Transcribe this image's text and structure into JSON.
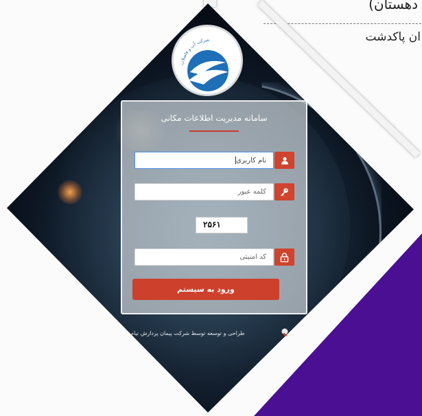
{
  "document": {
    "header_text": "دهستان)",
    "subheader_text": "ان پاکدشت"
  },
  "login": {
    "org_name_arc": "شرکت آب و فاضلاب",
    "title": "سامانه مدیریت اطلاعات مکانی",
    "username_placeholder": "نام کاربری",
    "password_placeholder": "کلمه عبور",
    "captcha_value": "۲۵۶۱",
    "security_code_placeholder": "کد امنیتی",
    "submit_label": "ورود به سیستم",
    "credit_text": "طراحی و توسعه توسط شرکت پیمان پردازش نیام"
  },
  "colors": {
    "accent_red": "#cd412c",
    "purple": "#4a0f93",
    "logo_blue": "#1f6fb8",
    "input_focus": "#4a90e2"
  },
  "icons": {
    "user": "user-icon",
    "key": "key-icon",
    "lock": "lock-icon"
  }
}
